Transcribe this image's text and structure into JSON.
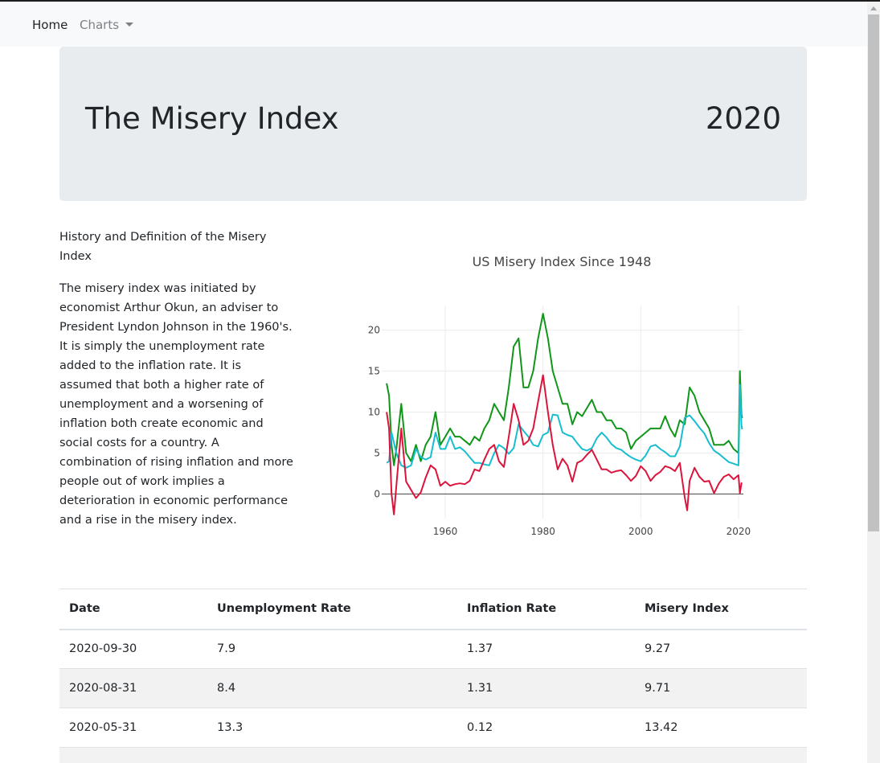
{
  "nav": {
    "home_label": "Home",
    "charts_label": "Charts"
  },
  "jumbotron": {
    "title": "The Misery Index",
    "year": "2020"
  },
  "intro": {
    "heading": "History and Definition of the Misery Index",
    "body": "The misery index was initiated by economist Arthur Okun, an adviser to President Lyndon Johnson in the 1960's. It is simply the unemployment rate added to the inflation rate. It is assumed that both a higher rate of unemployment and a worsening of inflation both create economic and social costs for a country. A combination of rising inflation and more people out of work implies a deterioration in economic performance and a rise in the misery index."
  },
  "chart_data": {
    "type": "line",
    "title": "US Misery Index Since 1948",
    "xlim": [
      1947,
      2021
    ],
    "ylim": [
      -3,
      23
    ],
    "x_ticks": [
      1960,
      1980,
      2000,
      2020
    ],
    "y_ticks": [
      0,
      5,
      10,
      15,
      20
    ],
    "grid": true,
    "legend": "none",
    "series": [
      {
        "color": "#109618",
        "x": [
          1948,
          1948.5,
          1949,
          1949.5,
          1950,
          1951,
          1952,
          1953,
          1954,
          1955,
          1956,
          1957,
          1958,
          1959,
          1960,
          1961,
          1962,
          1963,
          1964,
          1965,
          1966,
          1967,
          1968,
          1969,
          1970,
          1971,
          1972,
          1973,
          1974,
          1975,
          1976,
          1977,
          1978,
          1979,
          1980,
          1981,
          1982,
          1983,
          1984,
          1985,
          1986,
          1987,
          1988,
          1989,
          1990,
          1991,
          1992,
          1993,
          1994,
          1995,
          1996,
          1997,
          1998,
          1999,
          2000,
          2001,
          2002,
          2003,
          2004,
          2005,
          2006,
          2007,
          2008,
          2009,
          2010,
          2011,
          2012,
          2013,
          2014,
          2015,
          2016,
          2017,
          2018,
          2019,
          2020,
          2020.3,
          2020.6,
          2020.75
        ],
        "y": [
          13.5,
          12,
          6,
          3.5,
          5.5,
          11,
          5,
          4,
          6,
          4,
          6,
          7,
          10,
          6,
          7,
          8,
          7,
          7,
          6.5,
          6,
          7,
          6.5,
          8,
          9,
          11,
          10,
          9,
          13,
          18,
          19,
          13,
          13,
          15,
          19,
          22,
          19,
          15,
          13,
          11,
          11,
          8.5,
          10,
          9.5,
          10.5,
          11.5,
          10,
          10,
          9,
          9,
          8,
          8,
          7.5,
          5.5,
          6.5,
          7,
          7.5,
          8,
          8,
          8,
          9.5,
          8,
          7,
          9,
          8.5,
          13,
          12,
          10,
          9,
          8,
          6,
          6,
          6,
          6.5,
          5.5,
          5,
          15,
          9.71,
          9.27
        ]
      },
      {
        "color": "#17becf",
        "x": [
          1948,
          1948.5,
          1949,
          1950,
          1951,
          1952,
          1953,
          1954,
          1955,
          1956,
          1957,
          1958,
          1959,
          1960,
          1961,
          1962,
          1963,
          1964,
          1965,
          1966,
          1967,
          1968,
          1969,
          1970,
          1971,
          1972,
          1973,
          1974,
          1975,
          1976,
          1977,
          1978,
          1979,
          1980,
          1981,
          1982,
          1983,
          1984,
          1985,
          1986,
          1987,
          1988,
          1989,
          1990,
          1991,
          1992,
          1993,
          1994,
          1995,
          1996,
          1997,
          1998,
          1999,
          2000,
          2001,
          2002,
          2003,
          2004,
          2005,
          2006,
          2007,
          2008,
          2009,
          2010,
          2011,
          2012,
          2013,
          2014,
          2015,
          2016,
          2017,
          2018,
          2019,
          2020,
          2020.3,
          2020.6,
          2020.75
        ],
        "y": [
          3.8,
          4,
          7.5,
          5,
          3.5,
          3.2,
          3.5,
          5.5,
          4.5,
          4.2,
          4.5,
          7.5,
          5.5,
          5.5,
          7,
          5.5,
          5.7,
          5.2,
          4.5,
          3.8,
          3.8,
          3.6,
          3.5,
          5,
          6,
          5.6,
          4.9,
          5.6,
          8.5,
          7.7,
          7,
          6,
          5.8,
          7.2,
          7.5,
          9.7,
          9.6,
          7.5,
          7.2,
          7,
          6.2,
          5.5,
          5.3,
          5.6,
          6.8,
          7.5,
          6.9,
          6.1,
          5.6,
          5.4,
          4.9,
          4.5,
          4.2,
          4,
          4.7,
          5.8,
          6,
          5.5,
          5.1,
          4.6,
          4.6,
          5.8,
          9.3,
          9.6,
          8.9,
          8.1,
          7.4,
          6.2,
          5.3,
          4.9,
          4.4,
          3.9,
          3.7,
          3.5,
          13.3,
          8.4,
          7.9
        ]
      },
      {
        "color": "#dc143c",
        "x": [
          1948,
          1948.5,
          1949,
          1949.5,
          1950,
          1951,
          1952,
          1953,
          1954,
          1955,
          1956,
          1957,
          1958,
          1959,
          1960,
          1961,
          1962,
          1963,
          1964,
          1965,
          1966,
          1967,
          1968,
          1969,
          1970,
          1971,
          1972,
          1973,
          1974,
          1975,
          1976,
          1977,
          1978,
          1979,
          1980,
          1981,
          1982,
          1983,
          1984,
          1985,
          1986,
          1987,
          1988,
          1989,
          1990,
          1991,
          1992,
          1993,
          1994,
          1995,
          1996,
          1997,
          1998,
          1999,
          2000,
          2001,
          2002,
          2003,
          2004,
          2005,
          2006,
          2007,
          2008,
          2009,
          2009.5,
          2010,
          2011,
          2012,
          2013,
          2014,
          2015,
          2016,
          2017,
          2018,
          2019,
          2020,
          2020.3,
          2020.6,
          2020.75
        ],
        "y": [
          10,
          8,
          0,
          -2.5,
          1,
          8,
          1.5,
          0.5,
          -0.5,
          0.2,
          2,
          3.5,
          3,
          1,
          1.5,
          1,
          1.2,
          1.3,
          1.2,
          1.6,
          3,
          2.8,
          4.2,
          5.5,
          6,
          4,
          3.3,
          7,
          11,
          9,
          6,
          6.5,
          8,
          11.3,
          14.5,
          10,
          6,
          3,
          4.3,
          3.5,
          1.5,
          3.8,
          4.1,
          4.8,
          5.4,
          4.2,
          3,
          3,
          2.6,
          2.8,
          2.9,
          2.3,
          1.6,
          2.2,
          3.4,
          2.8,
          1.6,
          2.3,
          2.7,
          3.4,
          3.2,
          2.8,
          3.8,
          -0.4,
          -2,
          1.6,
          3.2,
          2.1,
          1.5,
          1.6,
          0.1,
          1.3,
          2.1,
          2.4,
          1.8,
          2.3,
          0.12,
          1.31,
          1.37
        ]
      }
    ]
  },
  "table": {
    "headers": {
      "date": "Date",
      "unemployment": "Unemployment Rate",
      "inflation": "Inflation Rate",
      "misery": "Misery Index"
    },
    "rows": [
      {
        "date": "2020-09-30",
        "unemployment": "7.9",
        "inflation": "1.37",
        "misery": "9.27"
      },
      {
        "date": "2020-08-31",
        "unemployment": "8.4",
        "inflation": "1.31",
        "misery": "9.71"
      },
      {
        "date": "2020-05-31",
        "unemployment": "13.3",
        "inflation": "0.12",
        "misery": "13.42"
      },
      {
        "date": "",
        "unemployment": "",
        "inflation": "",
        "misery": ""
      }
    ]
  }
}
